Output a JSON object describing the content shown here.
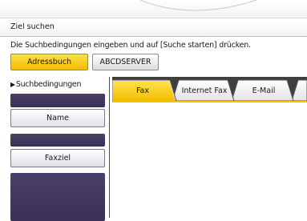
{
  "title": "Ziel suchen",
  "instruction": "Die Suchbedingungen eingeben und auf [Suche starten] drücken.",
  "sources": {
    "address_book_label": "Adressbuch",
    "server_label": "ABCDSERVER"
  },
  "criteria": {
    "label": "Suchbedingungen",
    "name_label": "Name",
    "fax_dest_label": "Faxziel"
  },
  "tabs": [
    {
      "label": "Fax",
      "selected": true
    },
    {
      "label": "Internet Fax",
      "selected": false
    },
    {
      "label": "E-Mail",
      "selected": false
    }
  ],
  "colors": {
    "accent_yellow": "#f5c400",
    "panel_dark": "#3f3458",
    "tab_strip": "#3f3f3f"
  }
}
